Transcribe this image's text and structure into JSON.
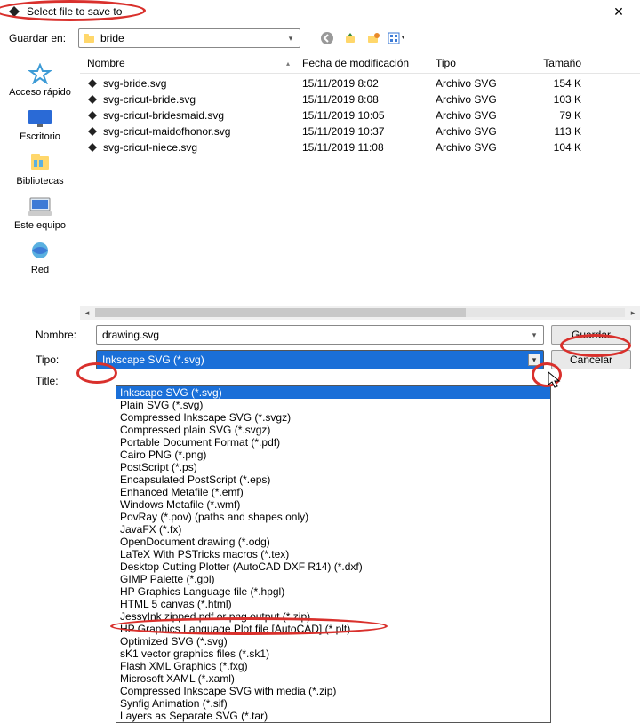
{
  "titlebar": {
    "title": "Select file to save to"
  },
  "toolbar": {
    "save_in_label": "Guardar en:",
    "folder_name": "bride"
  },
  "columns": {
    "name": "Nombre",
    "date": "Fecha de modificación",
    "type": "Tipo",
    "size": "Tamaño"
  },
  "places": {
    "quick": "Acceso rápido",
    "desktop": "Escritorio",
    "libraries": "Bibliotecas",
    "thispc": "Este equipo",
    "network": "Red"
  },
  "files": [
    {
      "name": "svg-bride.svg",
      "date": "15/11/2019 8:02",
      "type": "Archivo SVG",
      "size": "154 K"
    },
    {
      "name": "svg-cricut-bride.svg",
      "date": "15/11/2019 8:08",
      "type": "Archivo SVG",
      "size": "103 K"
    },
    {
      "name": "svg-cricut-bridesmaid.svg",
      "date": "15/11/2019 10:05",
      "type": "Archivo SVG",
      "size": "79 K"
    },
    {
      "name": "svg-cricut-maidofhonor.svg",
      "date": "15/11/2019 10:37",
      "type": "Archivo SVG",
      "size": "113 K"
    },
    {
      "name": "svg-cricut-niece.svg",
      "date": "15/11/2019 11:08",
      "type": "Archivo SVG",
      "size": "104 K"
    }
  ],
  "form": {
    "name_label": "Nombre:",
    "type_label": "Tipo:",
    "title_label": "Title:",
    "filename": "drawing.svg",
    "type_selected": "Inkscape SVG (*.svg)",
    "save_label": "Guardar",
    "cancel_label": "Cancelar"
  },
  "type_options": [
    "Inkscape SVG (*.svg)",
    "Plain SVG (*.svg)",
    "Compressed Inkscape SVG (*.svgz)",
    "Compressed plain SVG (*.svgz)",
    "Portable Document Format (*.pdf)",
    "Cairo PNG (*.png)",
    "PostScript (*.ps)",
    "Encapsulated PostScript (*.eps)",
    "Enhanced Metafile (*.emf)",
    "Windows Metafile (*.wmf)",
    "PovRay (*.pov) (paths and shapes only)",
    "JavaFX (*.fx)",
    "OpenDocument drawing (*.odg)",
    "LaTeX With PSTricks macros (*.tex)",
    "Desktop Cutting Plotter (AutoCAD DXF R14) (*.dxf)",
    "GIMP Palette (*.gpl)",
    "HP Graphics Language file (*.hpgl)",
    "HTML 5 canvas (*.html)",
    "JessyInk zipped pdf or png output (*.zip)",
    "HP Graphics Language Plot file [AutoCAD] (*.plt)",
    "Optimized SVG (*.svg)",
    "sK1 vector graphics files (*.sk1)",
    "Flash XML Graphics (*.fxg)",
    "Microsoft XAML (*.xaml)",
    "Compressed Inkscape SVG with media (*.zip)",
    "Synfig Animation (*.sif)",
    "Layers as Separate SVG (*.tar)"
  ]
}
